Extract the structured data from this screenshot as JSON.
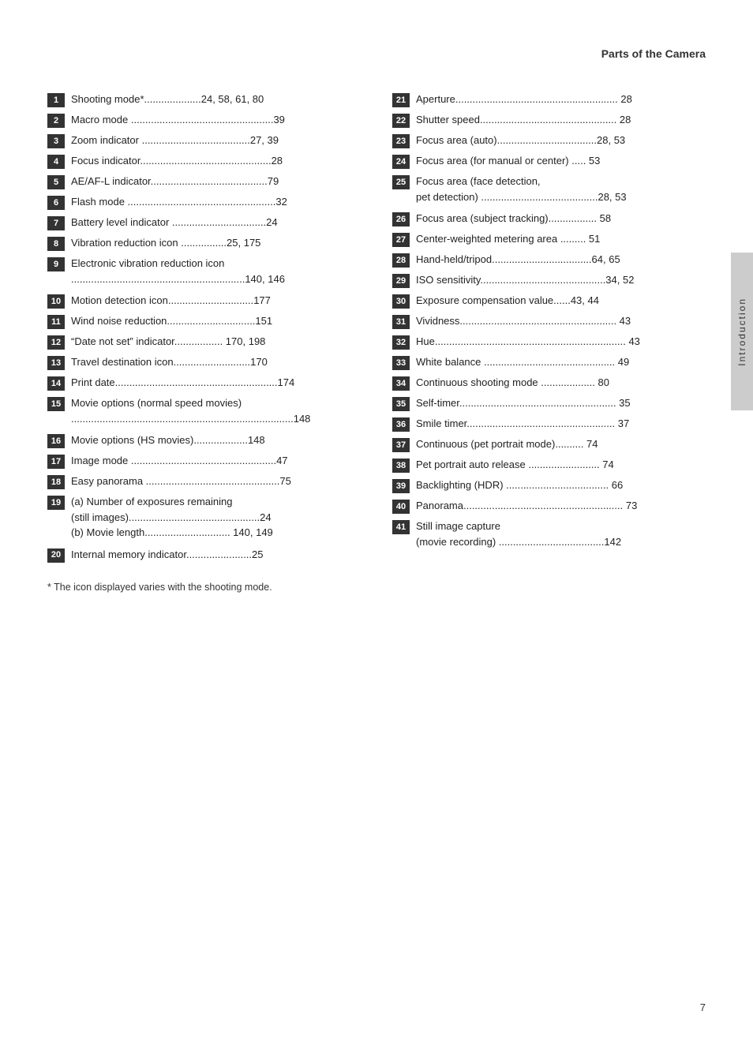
{
  "header": {
    "title": "Parts of the Camera"
  },
  "sidebar_label": "Introduction",
  "page_number": "7",
  "footnote": "*  The icon displayed varies with the shooting mode.",
  "left_entries": [
    {
      "num": "1",
      "text": "Shooting mode*....................24, 58, 61, 80"
    },
    {
      "num": "2",
      "text": "Macro mode ..................................................39"
    },
    {
      "num": "3",
      "text": "Zoom indicator ......................................27, 39"
    },
    {
      "num": "4",
      "text": "Focus indicator..............................................28"
    },
    {
      "num": "5",
      "text": "AE/AF-L indicator.........................................79"
    },
    {
      "num": "6",
      "text": "Flash mode ....................................................32"
    },
    {
      "num": "7",
      "text": "Battery level indicator .................................24"
    },
    {
      "num": "8",
      "text": "Vibration reduction icon ................25, 175"
    },
    {
      "num": "9",
      "text": "Electronic vibration reduction icon\n.............................................................140, 146"
    },
    {
      "num": "10",
      "text": "Motion detection icon..............................177"
    },
    {
      "num": "11",
      "text": "Wind noise reduction...............................151"
    },
    {
      "num": "12",
      "text": "“Date not set” indicator................. 170, 198"
    },
    {
      "num": "13",
      "text": "Travel destination icon...........................170"
    },
    {
      "num": "14",
      "text": "Print date.........................................................174"
    },
    {
      "num": "15",
      "text": "Movie options (normal speed movies)\n..............................................................................148"
    },
    {
      "num": "16",
      "text": "Movie options (HS movies)...................148"
    },
    {
      "num": "17",
      "text": "Image mode ...................................................47"
    },
    {
      "num": "18",
      "text": "Easy panorama ...............................................75"
    },
    {
      "num": "19",
      "text": "(a)  Number of exposures remaining\n        (still images)..............................................24\n(b) Movie length.............................. 140, 149"
    },
    {
      "num": "20",
      "text": "Internal memory indicator.......................25"
    }
  ],
  "right_entries": [
    {
      "num": "21",
      "text": "Aperture......................................................... 28"
    },
    {
      "num": "22",
      "text": "Shutter speed................................................ 28"
    },
    {
      "num": "23",
      "text": "Focus area (auto)...................................28, 53"
    },
    {
      "num": "24",
      "text": "Focus area (for manual or center) ..... 53"
    },
    {
      "num": "25",
      "text": "Focus area (face detection,\npet detection) .........................................28, 53"
    },
    {
      "num": "26",
      "text": "Focus area (subject tracking)................. 58"
    },
    {
      "num": "27",
      "text": "Center-weighted metering area ......... 51"
    },
    {
      "num": "28",
      "text": "Hand-held/tripod...................................64, 65"
    },
    {
      "num": "29",
      "text": "ISO sensitivity............................................34, 52"
    },
    {
      "num": "30",
      "text": "Exposure compensation value......43, 44"
    },
    {
      "num": "31",
      "text": "Vividness....................................................... 43"
    },
    {
      "num": "32",
      "text": "Hue................................................................... 43"
    },
    {
      "num": "33",
      "text": "White balance .............................................. 49"
    },
    {
      "num": "34",
      "text": "Continuous shooting mode ................... 80"
    },
    {
      "num": "35",
      "text": "Self-timer....................................................... 35"
    },
    {
      "num": "36",
      "text": "Smile timer.................................................... 37"
    },
    {
      "num": "37",
      "text": "Continuous (pet portrait mode).......... 74"
    },
    {
      "num": "38",
      "text": "Pet portrait auto release ......................... 74"
    },
    {
      "num": "39",
      "text": "Backlighting (HDR) .................................... 66"
    },
    {
      "num": "40",
      "text": "Panorama........................................................ 73"
    },
    {
      "num": "41",
      "text": "Still image capture\n(movie recording)  .....................................142"
    }
  ]
}
